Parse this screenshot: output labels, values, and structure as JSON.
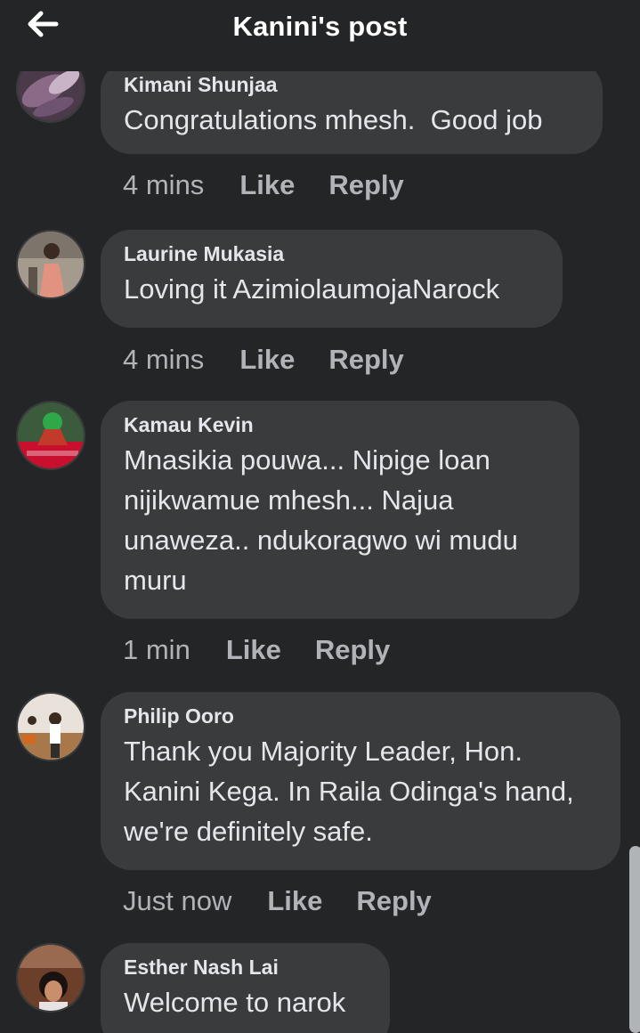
{
  "header": {
    "title": "Kanini's post",
    "back_icon": "arrow-left-icon"
  },
  "comments": [
    {
      "author": "Kimani Shunjaa",
      "text": "Congratulations mhesh.  Good job",
      "time": "4 mins",
      "like": "Like",
      "reply": "Reply"
    },
    {
      "author": "Laurine Mukasia",
      "text": "Loving it AzimiolaumojaNarock",
      "time": "4 mins",
      "like": "Like",
      "reply": "Reply"
    },
    {
      "author": "Kamau Kevin",
      "text": "Mnasikia pouwa... Nipige loan\nnijikwamue mhesh... Najua\nunaweza.. ndukoragwo wi mudu\nmuru",
      "time": "1 min",
      "like": "Like",
      "reply": "Reply"
    },
    {
      "author": "Philip Ooro",
      "text": "Thank you Majority Leader, Hon.\nKanini Kega. In Raila Odinga's hand,\nwe're definitely safe.",
      "time": "Just now",
      "like": "Like",
      "reply": "Reply"
    },
    {
      "author": "Esther Nash Lai",
      "text": "Welcome to narok"
    }
  ],
  "colors": {
    "background": "#242526",
    "bubble": "#3a3b3c",
    "primary_text": "#e4e6eb",
    "secondary_text": "#b0b3b8"
  }
}
